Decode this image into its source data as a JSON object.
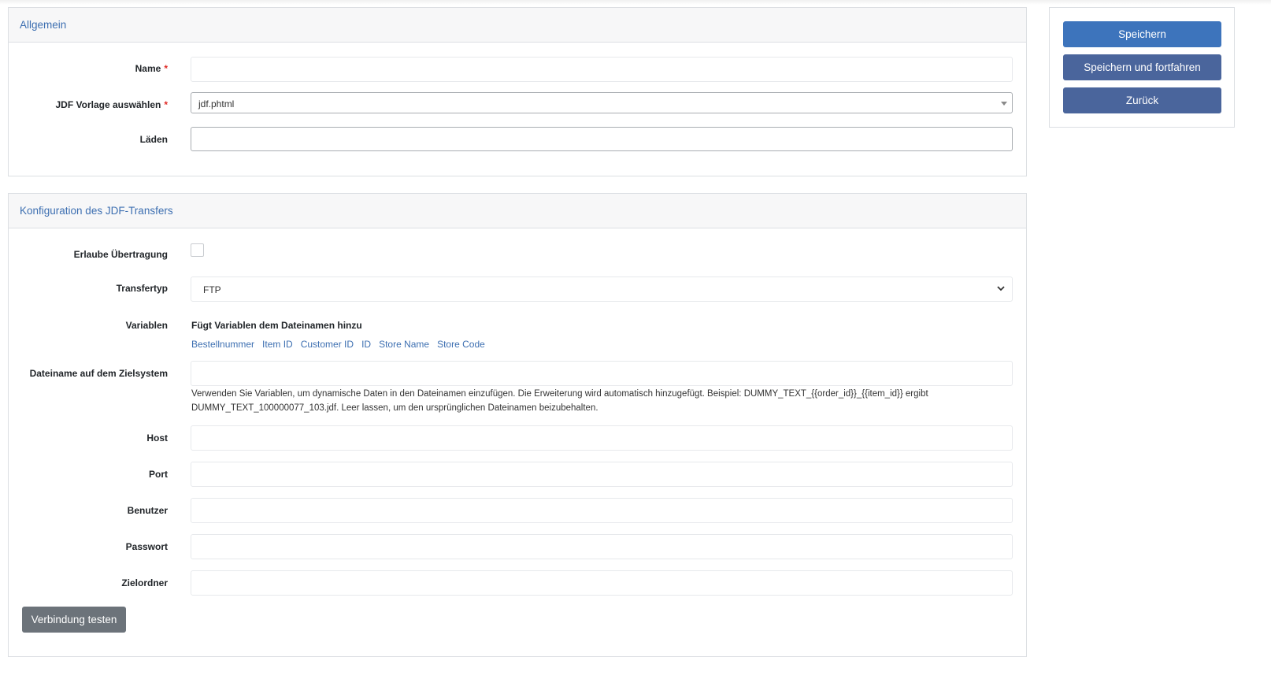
{
  "general": {
    "title": "Allgemein",
    "name_label": "Name",
    "name_value": "",
    "template_label": "JDF Vorlage auswählen",
    "template_value": "jdf.phtml",
    "stores_label": "Läden",
    "stores_value": "",
    "required_mark": "*"
  },
  "transfer": {
    "title": "Konfiguration des JDF-Transfers",
    "allow_label": "Erlaube Übertragung",
    "allow_checked": false,
    "type_label": "Transfertyp",
    "type_value": "FTP",
    "variables_label": "Variablen",
    "variables_title": "Fügt Variablen dem Dateinamen hinzu",
    "variables": [
      "Bestellnummer",
      "Item ID",
      "Customer ID",
      "ID",
      "Store Name",
      "Store Code"
    ],
    "filename_label": "Dateiname auf dem Zielsystem",
    "filename_value": "",
    "filename_hint": "Verwenden Sie Variablen, um dynamische Daten in den Dateinamen einzufügen. Die Erweiterung wird automatisch hinzugefügt. Beispiel: DUMMY_TEXT_{{order_id}}_{{item_id}} ergibt DUMMY_TEXT_100000077_103.jdf. Leer lassen, um den ursprünglichen Dateinamen beizubehalten.",
    "host_label": "Host",
    "port_label": "Port",
    "user_label": "Benutzer",
    "password_label": "Passwort",
    "folder_label": "Zielordner",
    "test_button": "Verbindung testen"
  },
  "actions": {
    "save": "Speichern",
    "save_continue": "Speichern und fortfahren",
    "back": "Zurück"
  },
  "colors": {
    "primary": "#3d74bc",
    "secondary": "#4a659c",
    "gray_button": "#6c737a",
    "link": "#3d6fb1",
    "required": "#e02b27"
  }
}
